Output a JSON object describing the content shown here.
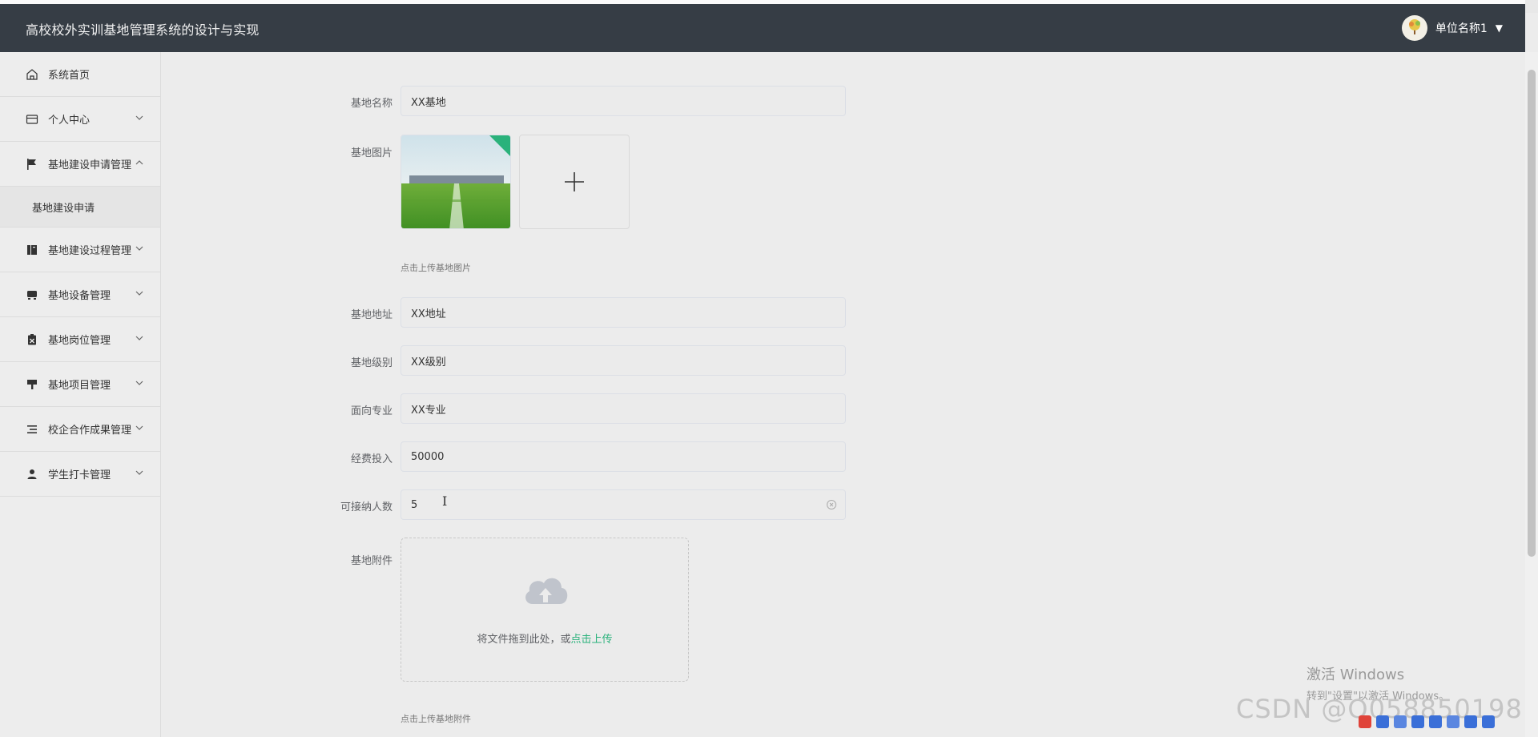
{
  "header": {
    "app_title": "高校校外实训基地管理系统的设计与实现",
    "user_name": "单位名称1"
  },
  "sidebar": {
    "items": [
      {
        "label": "系统首页",
        "icon": "home-icon"
      },
      {
        "label": "个人中心",
        "icon": "card-icon"
      },
      {
        "label": "基地建设申请管理",
        "icon": "flag-icon",
        "expanded": true,
        "children": [
          {
            "label": "基地建设申请"
          }
        ]
      },
      {
        "label": "基地建设过程管理",
        "icon": "book-icon"
      },
      {
        "label": "基地设备管理",
        "icon": "device-icon"
      },
      {
        "label": "基地岗位管理",
        "icon": "clipboard-icon"
      },
      {
        "label": "基地项目管理",
        "icon": "paint-icon"
      },
      {
        "label": "校企合作成果管理",
        "icon": "list-icon"
      },
      {
        "label": "学生打卡管理",
        "icon": "user-icon"
      }
    ]
  },
  "form": {
    "base_name": {
      "label": "基地名称",
      "value": "XX基地"
    },
    "base_image": {
      "label": "基地图片",
      "hint": "点击上传基地图片"
    },
    "base_address": {
      "label": "基地地址",
      "value": "XX地址"
    },
    "base_level": {
      "label": "基地级别",
      "value": "XX级别"
    },
    "major": {
      "label": "面向专业",
      "value": "XX专业"
    },
    "funding": {
      "label": "经费投入",
      "value": "50000"
    },
    "capacity": {
      "label": "可接纳人数",
      "value": "5"
    },
    "attachment": {
      "label": "基地附件",
      "drop_text": "将文件拖到此处，或",
      "drop_link": "点击上传",
      "hint": "点击上传基地附件"
    }
  },
  "overlay": {
    "activate_line1": "激活 Windows",
    "activate_line2": "转到\"设置\"以激活 Windows。",
    "watermark": "CSDN @Q058850198"
  },
  "colors": {
    "header_bg": "#363d45",
    "accent": "#2ab27b"
  }
}
